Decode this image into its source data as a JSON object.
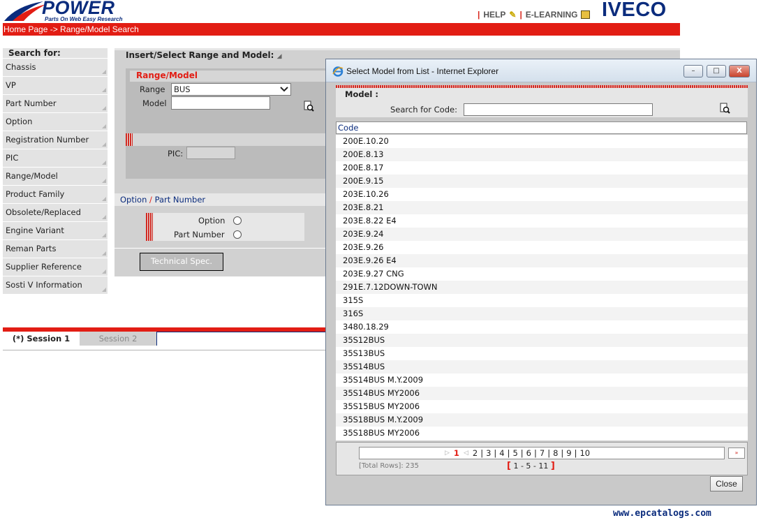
{
  "header": {
    "logo_text": "POWER",
    "logo_tagline": "Parts On Web Easy Research",
    "nav": {
      "help": "HELP",
      "elearning": "E-LEARNING"
    },
    "brand": "IVECO",
    "breadcrumb": "Home Page -> Range/Model Search"
  },
  "sidebar": {
    "heading": "Search for:",
    "items": [
      "Chassis",
      "VP",
      "Part Number",
      "Option",
      "Registration Number",
      "PIC",
      "Range/Model",
      "Product Family",
      "Obsolete/Replaced",
      "Engine Variant",
      "Reman Parts",
      "Supplier Reference",
      "Sosti V Information"
    ]
  },
  "main": {
    "title": "Insert/Select Range and Model:",
    "range_model": {
      "title": "Range/Model",
      "range_label": "Range",
      "range_value": "BUS",
      "model_label": "Model",
      "model_value": ""
    },
    "pic": {
      "label": "PIC:",
      "value": ""
    },
    "option_header": {
      "option": "Option",
      "slash": "/",
      "part_number": "Part Number"
    },
    "radios": {
      "option": "Option",
      "part_number": "Part Number"
    },
    "tech_spec_label": "Technical Spec."
  },
  "sessions": {
    "session1": "(*) Session 1",
    "session2": "Session 2"
  },
  "popup": {
    "title": "Select Model from List - Internet Explorer",
    "model_heading": "Model :",
    "search_label": "Search for Code:",
    "search_value": "",
    "column_header": "Code",
    "rows": [
      "200E.10.20",
      "200E.8.13",
      "200E.8.17",
      "200E.9.15",
      "203E.10.26",
      "203E.8.21",
      "203E.8.22 E4",
      "203E.9.24",
      "203E.9.26",
      "203E.9.26 E4",
      "203E.9.27 CNG",
      "291E.7.12DOWN-TOWN",
      "315S",
      "316S",
      "3480.18.29",
      "35S12BUS",
      "35S13BUS",
      "35S14BUS",
      "35S14BUS M.Y.2009",
      "35S14BUS MY2006",
      "35S15BUS MY2006",
      "35S18BUS M.Y.2009",
      "35S18BUS MY2006"
    ],
    "pager": {
      "current": "1",
      "pages": [
        "2",
        "3",
        "4",
        "5",
        "6",
        "7",
        "8",
        "9",
        "10"
      ],
      "next_symbol": "»",
      "total_rows": "[Total Rows]: 235",
      "page_range": "1 - 5 - 11"
    },
    "close_label": "Close",
    "window_buttons": {
      "minimize": "–",
      "maximize": "□",
      "close": "X"
    }
  },
  "watermark": "www.epcatalogs.com",
  "colors": {
    "brand_blue": "#0b2c7d",
    "accent_red": "#e21d14"
  }
}
